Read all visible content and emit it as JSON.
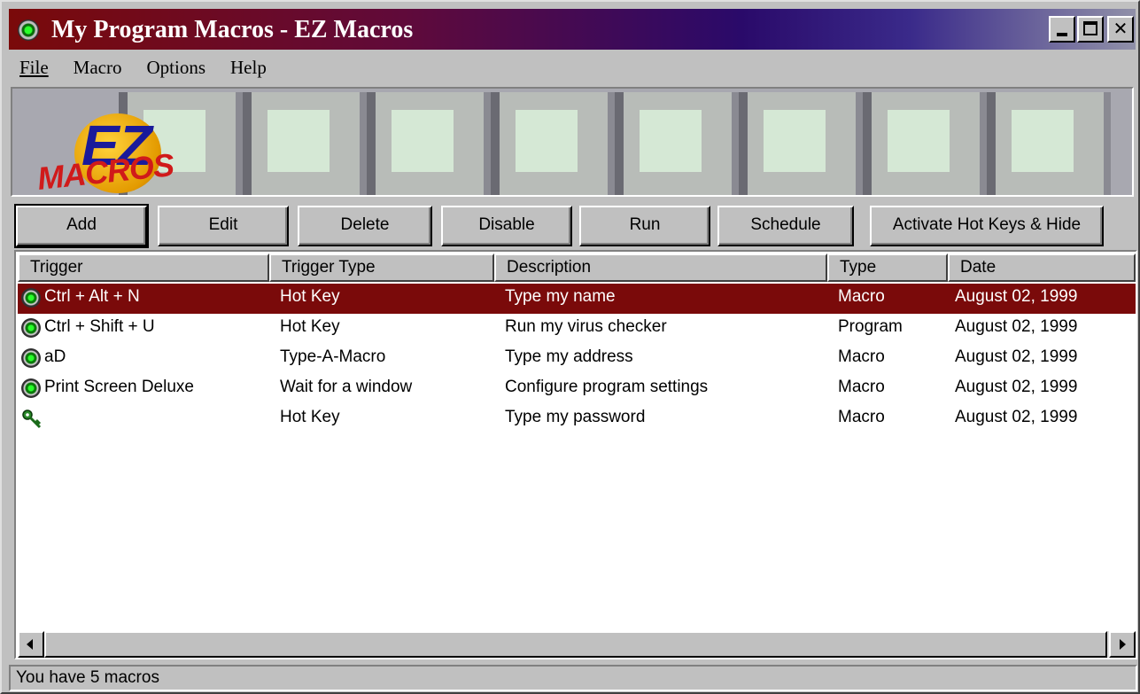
{
  "window": {
    "title": "My Program Macros - EZ Macros"
  },
  "menu": {
    "file": "File",
    "macro": "Macro",
    "options": "Options",
    "help": "Help"
  },
  "banner": {
    "logo_top": "EZ",
    "logo_bottom": "MACROS"
  },
  "toolbar": {
    "add": "Add",
    "edit": "Edit",
    "delete": "Delete",
    "disable": "Disable",
    "run": "Run",
    "schedule": "Schedule",
    "activate": "Activate Hot Keys & Hide"
  },
  "columns": {
    "trigger": "Trigger",
    "trigger_type": "Trigger Type",
    "description": "Description",
    "type": "Type",
    "date": "Date"
  },
  "rows": [
    {
      "trigger": "Ctrl + Alt + N",
      "trigger_type": "Hot Key",
      "description": "Type my name",
      "type": "Macro",
      "date": "August 02, 1999",
      "icon": "macro-target-icon",
      "selected": true
    },
    {
      "trigger": "Ctrl + Shift + U",
      "trigger_type": "Hot Key",
      "description": "Run my virus checker",
      "type": "Program",
      "date": "August 02, 1999",
      "icon": "macro-target-icon"
    },
    {
      "trigger": "aD",
      "trigger_type": "Type-A-Macro",
      "description": "Type my address",
      "type": "Macro",
      "date": "August 02, 1999",
      "icon": "macro-target-icon"
    },
    {
      "trigger": "Print Screen Deluxe",
      "trigger_type": "Wait for a window",
      "description": "Configure program settings",
      "type": "Macro",
      "date": "August 02, 1999",
      "icon": "macro-target-icon"
    },
    {
      "trigger": "",
      "trigger_type": "Hot Key",
      "description": "Type my password",
      "type": "Macro",
      "date": "August 02, 1999",
      "icon": "key-icon"
    }
  ],
  "status": {
    "text": "You have 5 macros"
  },
  "colors": {
    "selection": "#7a0a0a",
    "face": "#c0c0c0"
  }
}
